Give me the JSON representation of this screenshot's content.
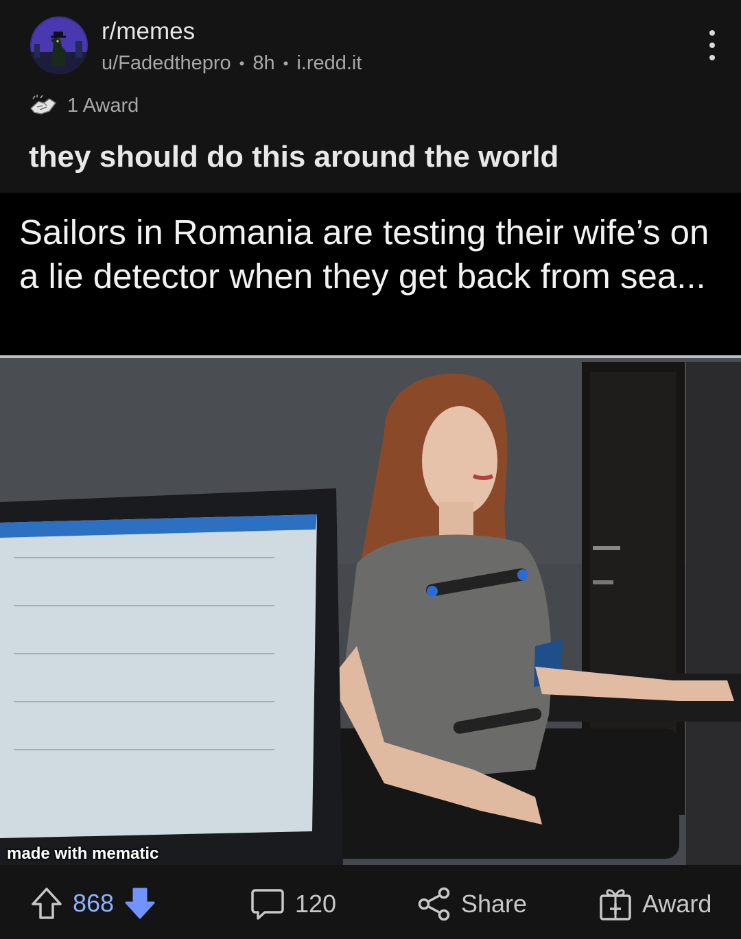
{
  "header": {
    "subreddit": "r/memes",
    "author": "u/Fadedthepro",
    "age": "8h",
    "domain": "i.redd.it",
    "separator": "•",
    "avatar_icon": "subreddit-avatar-icon",
    "menu_icon": "more-vertical-icon"
  },
  "awards": {
    "icon": "award-hands-icon",
    "label": "1 Award"
  },
  "post": {
    "title": "they should do this around the world"
  },
  "meme": {
    "caption": "Sailors in Romania are testing their wife’s on a lie detector when they get back from sea...",
    "watermark": "made with mematic"
  },
  "actions": {
    "upvote_icon": "upvote-arrow-icon",
    "score": "868",
    "downvote_icon": "downvote-arrow-icon",
    "comment_icon": "comment-bubble-icon",
    "comment_count": "120",
    "share_icon": "share-icon",
    "share_label": "Share",
    "award_icon": "gift-award-icon",
    "award_label": "Award"
  },
  "colors": {
    "background": "#141414",
    "score_blue": "#8fb0ff",
    "downvote_blue": "#7193ff",
    "text": "#d7dadc",
    "muted": "#a8a8a8"
  }
}
